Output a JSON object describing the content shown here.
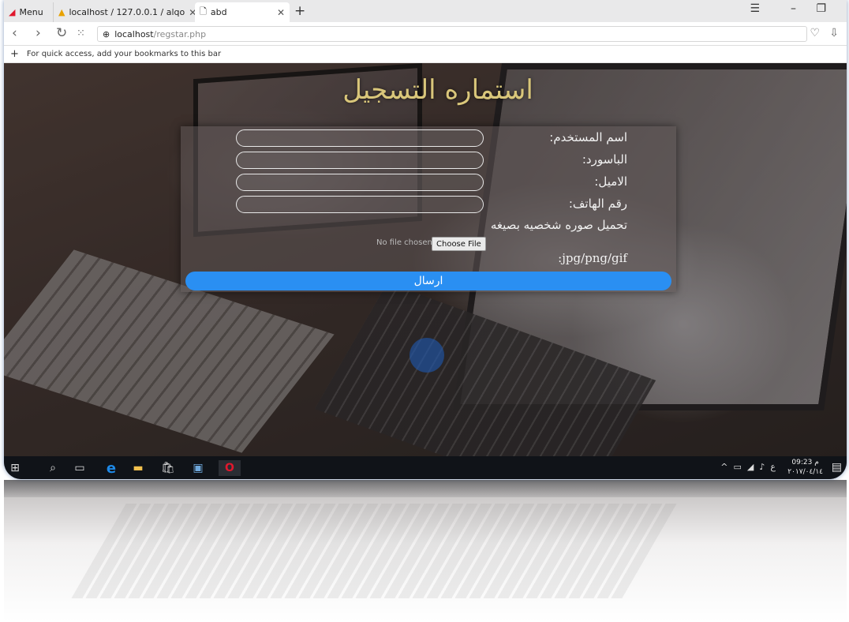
{
  "browser": {
    "tabs": [
      {
        "label": "Menu"
      },
      {
        "label": "localhost / 127.0.0.1 / alqo"
      },
      {
        "label": "abd"
      }
    ],
    "url_host": "localhost",
    "url_path": "/regstar.php",
    "bookmarks_hint": "For quick access, add your bookmarks to this bar"
  },
  "form": {
    "title": "استماره التسجيل",
    "username_label": "اسم المستخدم:",
    "password_label": "الباسورد:",
    "email_label": "الاميل:",
    "phone_label": "رقم الهاتف:",
    "upload_label": "تحميل صوره شخصيه بصيغه",
    "format_label": ":jpg/png/gif",
    "file_status": "No file chosen",
    "choose_file_label": "Choose File",
    "submit_label": "ارسال"
  },
  "taskbar": {
    "time": "09:23 م",
    "date": "٢٠١٧/٠٤/١٤",
    "lang": "ع"
  },
  "colors": {
    "submit_button": "#2a8ff2",
    "title_gold": "#d9c67a",
    "opera_red": "#e0182d"
  }
}
